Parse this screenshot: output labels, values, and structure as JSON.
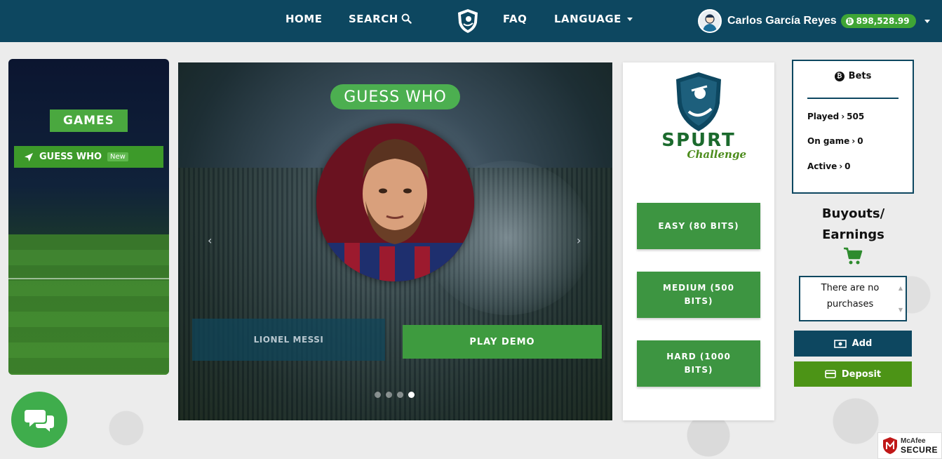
{
  "nav": {
    "home": "HOME",
    "search": "SEARCH",
    "faq": "FAQ",
    "language": "LANGUAGE",
    "user_name": "Carlos García Reyes",
    "balance": "898,528.99"
  },
  "games": {
    "title": "GAMES",
    "item_label": "GUESS WHO",
    "item_badge": "New"
  },
  "carousel": {
    "title": "GUESS WHO",
    "answer": "LIONEL MESSI",
    "play_label": "PLAY DEMO",
    "slides_count": 4,
    "active_slide": 4
  },
  "brand": {
    "main": "SPURT",
    "sub": "Challenge"
  },
  "difficulty": {
    "easy": "EASY (80 BITS)",
    "medium": "MEDIUM (500 BITS)",
    "hard": "HARD (1000 BITS)"
  },
  "bets": {
    "title": "Bets",
    "played_label": "Played",
    "played_value": "505",
    "on_game_label": "On game",
    "on_game_value": "0",
    "active_label": "Active",
    "active_value": "0"
  },
  "sidebar": {
    "buyouts_line1": "Buyouts/",
    "buyouts_line2": "Earnings",
    "purchases_empty": "There are no purchases",
    "add_label": "Add",
    "deposit_label": "Deposit"
  },
  "mcafee": {
    "brand": "McAfee",
    "secure": "SECURE"
  },
  "colors": {
    "navbar": "#0d4760",
    "accent_green": "#3e9b3f",
    "deposit_green": "#4c9416"
  },
  "icons": [
    "search-icon",
    "shield-logo-icon",
    "bitcoin-icon",
    "paper-plane-icon",
    "cart-icon",
    "cash-icon",
    "credit-card-icon",
    "chat-icon",
    "mcafee-shield-icon"
  ]
}
